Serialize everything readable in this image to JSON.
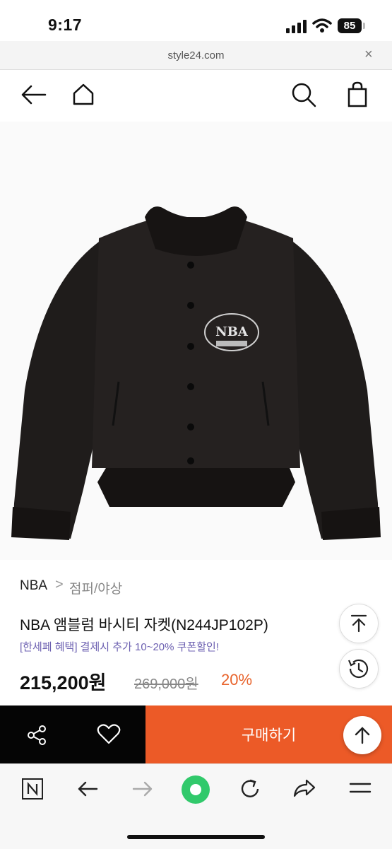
{
  "status_bar": {
    "time": "9:17",
    "battery": "85"
  },
  "browser": {
    "url": "style24.com",
    "close_glyph": "×"
  },
  "header": {
    "icons": [
      "back-arrow-icon",
      "home-icon",
      "search-icon",
      "shopping-bag-icon"
    ]
  },
  "product": {
    "image_alt": "black varsity jacket with NBA emblem",
    "emblem_text": "NBA",
    "breadcrumb": {
      "brand": "NBA",
      "separator": ">",
      "category": "점퍼/야상"
    },
    "title": "NBA 앰블럼 바시티 자켓(N244JP102P)",
    "promo": "[한세페 혜택] 결제시 추가 10~20% 쿠폰할인!",
    "price": "215,200원",
    "original_price": "269,000원",
    "discount": "20%"
  },
  "purchase_bar": {
    "buy_label": "구매하기",
    "icons": [
      "share-icon",
      "heart-icon"
    ]
  },
  "floating": {
    "icons": [
      "scroll-top-icon",
      "history-icon",
      "arrow-up-icon"
    ]
  },
  "toolbar": {
    "icons": [
      "naver-n-icon",
      "back-icon",
      "forward-icon",
      "green-dot-icon",
      "refresh-icon",
      "share-forward-icon",
      "menu-icon"
    ]
  },
  "colors": {
    "accent": "#ec5a27",
    "promo": "#6b5fb0",
    "discount": "#e8622a",
    "green": "#31c96b"
  }
}
